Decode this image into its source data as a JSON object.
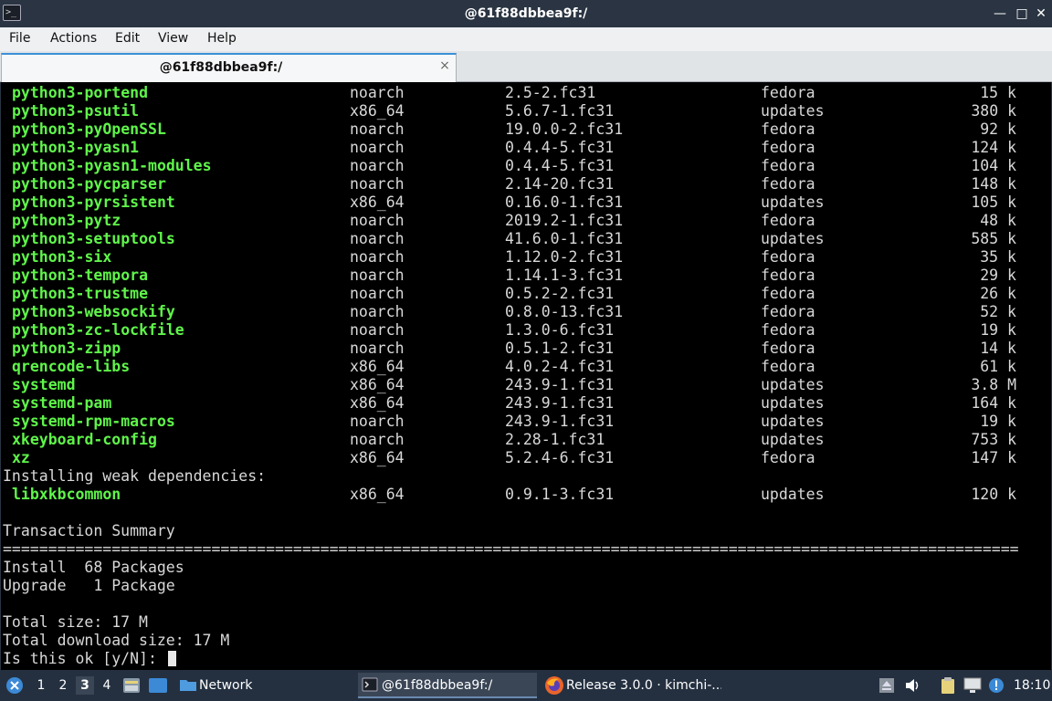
{
  "window": {
    "title": "@61f88dbbea9f:/"
  },
  "menu": [
    "File",
    "Actions",
    "Edit",
    "View",
    "Help"
  ],
  "tab": {
    "title": "@61f88dbbea9f:/",
    "close": "×"
  },
  "packages": [
    {
      "name": "python3-portend",
      "arch": "noarch",
      "version": "2.5-2.fc31",
      "repo": "fedora",
      "size": "15 k"
    },
    {
      "name": "python3-psutil",
      "arch": "x86_64",
      "version": "5.6.7-1.fc31",
      "repo": "updates",
      "size": "380 k"
    },
    {
      "name": "python3-pyOpenSSL",
      "arch": "noarch",
      "version": "19.0.0-2.fc31",
      "repo": "fedora",
      "size": "92 k"
    },
    {
      "name": "python3-pyasn1",
      "arch": "noarch",
      "version": "0.4.4-5.fc31",
      "repo": "fedora",
      "size": "124 k"
    },
    {
      "name": "python3-pyasn1-modules",
      "arch": "noarch",
      "version": "0.4.4-5.fc31",
      "repo": "fedora",
      "size": "104 k"
    },
    {
      "name": "python3-pycparser",
      "arch": "noarch",
      "version": "2.14-20.fc31",
      "repo": "fedora",
      "size": "148 k"
    },
    {
      "name": "python3-pyrsistent",
      "arch": "x86_64",
      "version": "0.16.0-1.fc31",
      "repo": "updates",
      "size": "105 k"
    },
    {
      "name": "python3-pytz",
      "arch": "noarch",
      "version": "2019.2-1.fc31",
      "repo": "fedora",
      "size": "48 k"
    },
    {
      "name": "python3-setuptools",
      "arch": "noarch",
      "version": "41.6.0-1.fc31",
      "repo": "updates",
      "size": "585 k"
    },
    {
      "name": "python3-six",
      "arch": "noarch",
      "version": "1.12.0-2.fc31",
      "repo": "fedora",
      "size": "35 k"
    },
    {
      "name": "python3-tempora",
      "arch": "noarch",
      "version": "1.14.1-3.fc31",
      "repo": "fedora",
      "size": "29 k"
    },
    {
      "name": "python3-trustme",
      "arch": "noarch",
      "version": "0.5.2-2.fc31",
      "repo": "fedora",
      "size": "26 k"
    },
    {
      "name": "python3-websockify",
      "arch": "noarch",
      "version": "0.8.0-13.fc31",
      "repo": "fedora",
      "size": "52 k"
    },
    {
      "name": "python3-zc-lockfile",
      "arch": "noarch",
      "version": "1.3.0-6.fc31",
      "repo": "fedora",
      "size": "19 k"
    },
    {
      "name": "python3-zipp",
      "arch": "noarch",
      "version": "0.5.1-2.fc31",
      "repo": "fedora",
      "size": "14 k"
    },
    {
      "name": "qrencode-libs",
      "arch": "x86_64",
      "version": "4.0.2-4.fc31",
      "repo": "fedora",
      "size": "61 k"
    },
    {
      "name": "systemd",
      "arch": "x86_64",
      "version": "243.9-1.fc31",
      "repo": "updates",
      "size": "3.8 M"
    },
    {
      "name": "systemd-pam",
      "arch": "x86_64",
      "version": "243.9-1.fc31",
      "repo": "updates",
      "size": "164 k"
    },
    {
      "name": "systemd-rpm-macros",
      "arch": "noarch",
      "version": "243.9-1.fc31",
      "repo": "updates",
      "size": "19 k"
    },
    {
      "name": "xkeyboard-config",
      "arch": "noarch",
      "version": "2.28-1.fc31",
      "repo": "updates",
      "size": "753 k"
    },
    {
      "name": "xz",
      "arch": "x86_64",
      "version": "5.2.4-6.fc31",
      "repo": "fedora",
      "size": "147 k"
    }
  ],
  "weak_header": "Installing weak dependencies:",
  "weak_packages": [
    {
      "name": "libxkbcommon",
      "arch": "x86_64",
      "version": "0.9.1-3.fc31",
      "repo": "updates",
      "size": "120 k"
    }
  ],
  "summary": {
    "title": "Transaction Summary",
    "separator": "================================================================================================================",
    "install": "Install  68 Packages",
    "upgrade": "Upgrade   1 Package",
    "total_size": "Total size: 17 M",
    "download_size": "Total download size: 17 M",
    "prompt": "Is this ok [y/N]: "
  },
  "taskbar": {
    "workspaces": [
      "1",
      "2",
      "3",
      "4"
    ],
    "active_workspace": "3",
    "network_label": "Network",
    "tasks": [
      {
        "label": "@61f88dbbea9f:/",
        "icon": "terminal-icon"
      },
      {
        "label": "Release 3.0.0 · kimchi-...",
        "icon": "firefox-icon"
      }
    ],
    "clock": "18:10"
  },
  "colors": {
    "package_name": "#5ff54a",
    "terminal_bg": "#000000",
    "titlebar_bg": "#2a3442",
    "taskbar_bg": "#243040",
    "tab_accent": "#3a8fd8"
  }
}
